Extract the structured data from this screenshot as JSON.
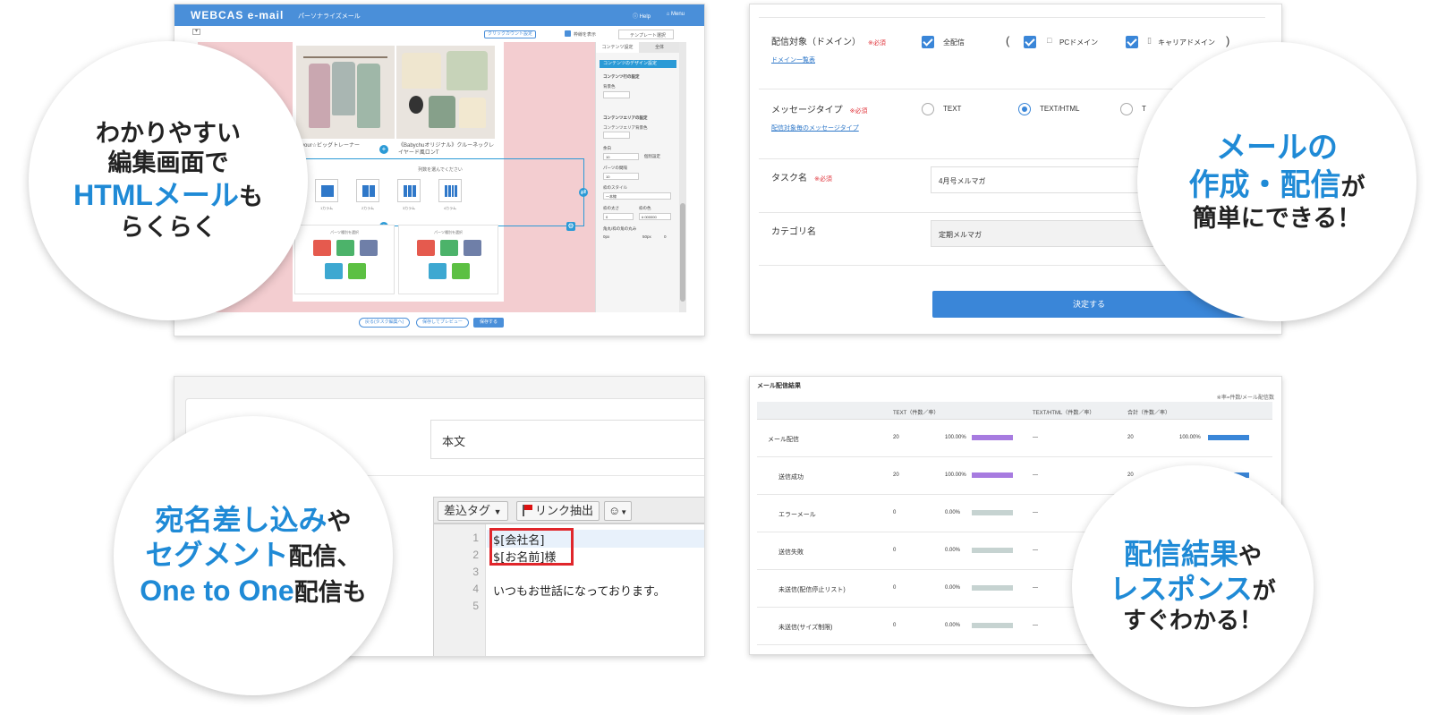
{
  "colors": {
    "accent": "#1f8ad6",
    "header": "#4a8fd9",
    "required": "#e0333a",
    "bar_purple": "#a77be0",
    "bar_blue": "#3a86d8",
    "bar_gray": "#c6d3d1",
    "highlight_box": "#e0262b"
  },
  "editor": {
    "logo": "WEBCAS e-mail",
    "subtitle": "パーソナライズメール",
    "help": "Help",
    "menu": "Menu",
    "clickcount_btn": "クリックカウント設定",
    "frame_label": "枠線を表示",
    "template_select": "テンプレート選択",
    "product1": "your☆ビッグトレーナー",
    "product2": "《Babychuオリジナル》クルーネックレイヤード風ロンT",
    "column_prompt": "列数を選んでください",
    "columns": [
      {
        "label": "1カラム",
        "bars": 1
      },
      {
        "label": "2カラム",
        "bars": 2
      },
      {
        "label": "3カラム",
        "bars": 3
      },
      {
        "label": "4カラム",
        "bars": 4
      }
    ],
    "parts_prompt": "パーツ種別を選択",
    "side": {
      "tab_content": "コンテンツ設定",
      "tab_all": "全体",
      "design_header": "コンテンツのデザイン設定",
      "row_settings": "コンテンツ行の設定",
      "bg_color": "背景色",
      "area_settings": "コンテンツエリアの設定",
      "area_bg": "コンテンツエリア背景色",
      "margin": "余白",
      "margin_value": "10",
      "individual": "個別設定",
      "parts_gap": "パーツの間隔",
      "gap_value": "10",
      "border_style": "枠のスタイル",
      "border_style_value": "一本線",
      "border_width": "枠の太さ",
      "border_width_value": "0",
      "border_color": "枠の色",
      "border_color_value": "# 000000",
      "radius": "角丸/枠の角の丸み",
      "radius_min": "0px",
      "radius_max": "50px",
      "radius_value": "0"
    },
    "btn_back": "戻る(タスク編集へ)",
    "btn_preview": "保存してプレビュー",
    "btn_save": "保存する"
  },
  "form": {
    "domain_label": "配信対象（ドメイン）",
    "required": "※必須",
    "domain_link": "ドメイン一覧表",
    "opt_all": "全配信",
    "paren_open": "(",
    "paren_close": ")",
    "opt_pc": "PCドメイン",
    "opt_carrier": "キャリアドメイン",
    "msgtype_label": "メッセージタイプ",
    "msgtype_link": "配信対象毎のメッセージタイプ",
    "opt_text": "TEXT",
    "opt_texthtml": "TEXT/HTML",
    "opt_t": "T",
    "task_label": "タスク名",
    "task_value": "4月号メルマガ",
    "category_label": "カテゴリ名",
    "category_value": "定期メルマガ",
    "submit": "決定する"
  },
  "code": {
    "body_label": "本文",
    "insert_tag": "差込タグ",
    "link_extract": "リンク抽出",
    "lines": [
      {
        "n": "1",
        "text": "$[会社名]"
      },
      {
        "n": "2",
        "text": "$[お名前]様"
      },
      {
        "n": "3",
        "text": ""
      },
      {
        "n": "4",
        "text": "いつもお世話になっております。"
      },
      {
        "n": "5",
        "text": ""
      }
    ]
  },
  "stats": {
    "title": "メール配信結果",
    "note": "※率=件数/メール配信数",
    "col_text": "TEXT（件数／率）",
    "col_html": "TEXT/HTML（件数／率）",
    "col_total": "合計（件数／率）",
    "rows": [
      {
        "name": "メール配信",
        "count": "20",
        "rate": "100.00%",
        "rate_value": 100,
        "html": "—",
        "total": "20",
        "total_rate": "100.00%",
        "total_value": 100
      },
      {
        "name": "送信成功",
        "count": "20",
        "rate": "100.00%",
        "rate_value": 100,
        "html": "—",
        "total": "20",
        "total_rate": "",
        "total_value": 100
      },
      {
        "name": "エラーメール",
        "count": "0",
        "rate": "0.00%",
        "rate_value": 0,
        "html": "—",
        "total": "",
        "total_rate": "",
        "total_value": 0
      },
      {
        "name": "送信失敗",
        "count": "0",
        "rate": "0.00%",
        "rate_value": 0,
        "html": "—",
        "total": "",
        "total_rate": "",
        "total_value": 0
      },
      {
        "name": "未送信(配信停止リスト)",
        "count": "0",
        "rate": "0.00%",
        "rate_value": 0,
        "html": "—",
        "total": "",
        "total_rate": "",
        "total_value": 0
      },
      {
        "name": "未送信(サイズ制限)",
        "count": "0",
        "rate": "0.00%",
        "rate_value": 0,
        "html": "—",
        "total": "",
        "total_rate": "",
        "total_value": 0
      }
    ]
  },
  "callouts": {
    "c1": {
      "l1": "わかりやすい",
      "l2": "編集画面で",
      "l3a": "HTMLメール",
      "l3b": "も",
      "l4": "らくらく"
    },
    "c2": {
      "l1": "メールの",
      "l2a": "作成・配信",
      "l2b": "が",
      "l3": "簡単にできる！"
    },
    "c3": {
      "l1a": "宛名差し込み",
      "l1b": "や",
      "l2a": "セグメント",
      "l2b": "配信、",
      "l3a": "One to One",
      "l3b": "配信も"
    },
    "c4": {
      "l1a": "配信結果",
      "l1b": "や",
      "l2a": "レスポンス",
      "l2b": "が",
      "l3": "すぐわかる！"
    }
  }
}
